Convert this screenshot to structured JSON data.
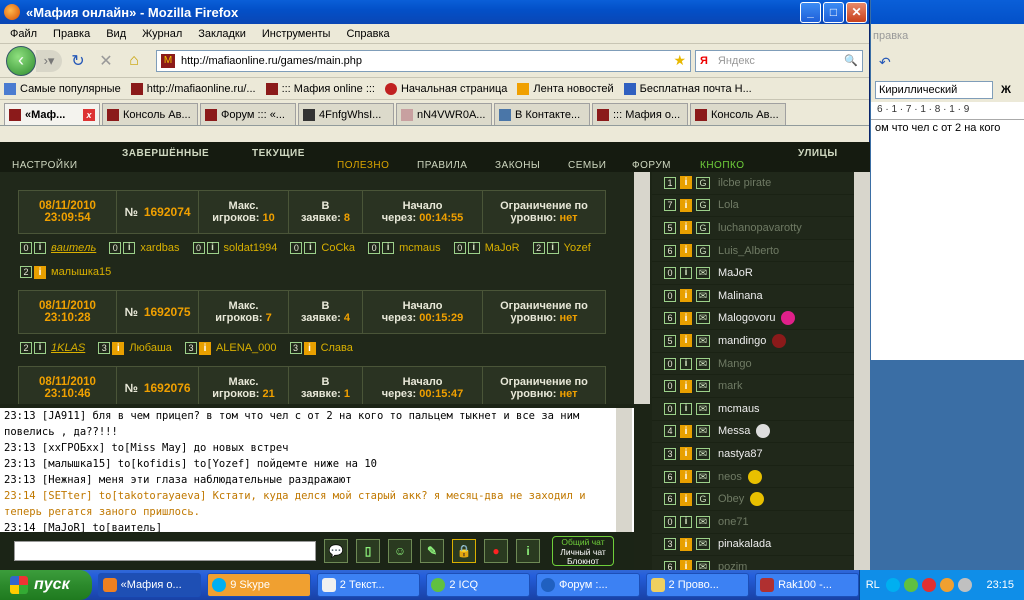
{
  "browser": {
    "title": "«Мафия онлайн» - Mozilla Firefox",
    "menu": [
      "Файл",
      "Правка",
      "Вид",
      "Журнал",
      "Закладки",
      "Инструменты",
      "Справка"
    ],
    "url": "http://mafiaonline.ru/games/main.php",
    "search_placeholder": "Яндекс",
    "bookmarks": [
      "Самые популярные",
      "http://mafiaonline.ru/...",
      "::: Мафия online :::",
      "Начальная страница",
      "Лента новостей",
      "Бесплатная почта Н..."
    ],
    "tabs": [
      "«Маф...",
      "Консоль Ав...",
      "Форум ::: «...",
      "4FnfgWhsI...",
      "nN4VWR0A...",
      "В Контакте...",
      "::: Мафия о...",
      "Консоль Ав..."
    ]
  },
  "site_nav": {
    "row1": [
      "ЗАВЕРШЁННЫЕ",
      "ТЕКУЩИЕ",
      "УЛИЦЫ"
    ],
    "row2": [
      "НАСТРОЙКИ",
      "ПОЛЕЗНО",
      "ПРАВИЛА",
      "ЗАКОНЫ",
      "СЕМЬИ",
      "ФОРУМ",
      "КНОПКО"
    ]
  },
  "labels": {
    "max_players": "Макс.",
    "players": "игроков:",
    "in": "В",
    "request": "заявке:",
    "start": "Начало",
    "after": "через:",
    "limit": "Ограничение по",
    "level": "уровню:",
    "num": "№"
  },
  "games": [
    {
      "date": "08/11/2010",
      "time": "23:09:54",
      "num": "1692074",
      "max": "10",
      "inq": "8",
      "start": "00:14:55",
      "level": "нет",
      "players": [
        [
          "0",
          "вaитeль"
        ],
        [
          "0",
          "xardbas"
        ],
        [
          "0",
          "soldat1994"
        ],
        [
          "0",
          "CoCka"
        ],
        [
          "0",
          "mcmaus"
        ],
        [
          "0",
          "MaJoR"
        ],
        [
          "2",
          "Yozef"
        ],
        [
          "2",
          "малышка15"
        ]
      ]
    },
    {
      "date": "08/11/2010",
      "time": "23:10:28",
      "num": "1692075",
      "max": "7",
      "inq": "4",
      "start": "00:15:29",
      "level": "нет",
      "players": [
        [
          "2",
          "1KLAS"
        ],
        [
          "3",
          "Любаша"
        ],
        [
          "3",
          "ALENA_000"
        ],
        [
          "3",
          "Слава"
        ]
      ]
    },
    {
      "date": "08/11/2010",
      "time": "23:10:46",
      "num": "1692076",
      "max": "21",
      "inq": "1",
      "start": "00:15:47",
      "level": "нет",
      "players": []
    }
  ],
  "chat": [
    "23:13 [JA911] бля в чем прицеп? в том что чел с от 2 на кого то пальцем тыкнет и все за ним повелись , да??!!!",
    "23:13 [xxГРОБxx] to[Miss May] до новых встреч",
    "23:13 [малышка15] to[kofidis] to[Yozef] пойдемте ниже на 10",
    "23:13 [Нежная] меня эти глаза наблюдательные раздражают",
    "23:14 [SETter] to[takotorayaeva] Кстати, куда делся мой старый акк? я месяц-два не заходил и теперь регатся заного пришлось.",
    "23:14 [MaJoR] to[ваитель]"
  ],
  "chat_mode": [
    "Общий чат",
    "Личный чат",
    "Блокнот"
  ],
  "online_players": [
    {
      "n": "1",
      "name": "ilcbe pirate",
      "dim": true,
      "mark": "G"
    },
    {
      "n": "7",
      "name": "Lola",
      "dim": true,
      "mark": "G"
    },
    {
      "n": "5",
      "name": "luchanopavarotty",
      "dim": true,
      "mark": "G"
    },
    {
      "n": "6",
      "name": "Luis_Alberto",
      "dim": true,
      "mark": "G"
    },
    {
      "n": "0",
      "name": "MaJoR",
      "dim": false,
      "mark": "env",
      "gi": true
    },
    {
      "n": "0",
      "name": "Malinana",
      "dim": false,
      "mark": "env"
    },
    {
      "n": "6",
      "name": "Malogovoru",
      "dim": false,
      "mark": "env",
      "badge": "#e0208a"
    },
    {
      "n": "5",
      "name": "mandingo",
      "dim": false,
      "mark": "env",
      "badge": "#8b1a1a"
    },
    {
      "n": "0",
      "name": "Mango",
      "dim": true,
      "mark": "env",
      "gi": true
    },
    {
      "n": "0",
      "name": "mark",
      "dim": true,
      "mark": "env"
    },
    {
      "n": "0",
      "name": "mcmaus",
      "dim": false,
      "mark": "env",
      "gi": true
    },
    {
      "n": "4",
      "name": "Messa",
      "dim": false,
      "mark": "env",
      "badge": "#dddddd"
    },
    {
      "n": "3",
      "name": "nastya87",
      "dim": false,
      "mark": "env"
    },
    {
      "n": "6",
      "name": "neos",
      "dim": true,
      "mark": "env",
      "badge": "#e8c000"
    },
    {
      "n": "6",
      "name": "Obey",
      "dim": true,
      "mark": "G",
      "badge": "#e8c000"
    },
    {
      "n": "0",
      "name": "one71",
      "dim": true,
      "mark": "env",
      "gi": true
    },
    {
      "n": "3",
      "name": "pinakalada",
      "dim": false,
      "mark": "env"
    },
    {
      "n": "6",
      "name": "pozim",
      "dim": true,
      "mark": "env"
    }
  ],
  "word": {
    "menu": "правка",
    "font": "Кириллический",
    "ruler": "6 · 1 · 7 · 1 · 8 · 1 · 9",
    "text": "ом что чел с от 2 на кого"
  },
  "taskbar": {
    "start": "пуск",
    "items": [
      "«Мафия о...",
      "9 Skype",
      "2 Текст...",
      "2 ICQ",
      "Форум :...",
      "2 Прово...",
      "Rak100 -..."
    ],
    "lang": "RL",
    "clock": "23:15"
  }
}
